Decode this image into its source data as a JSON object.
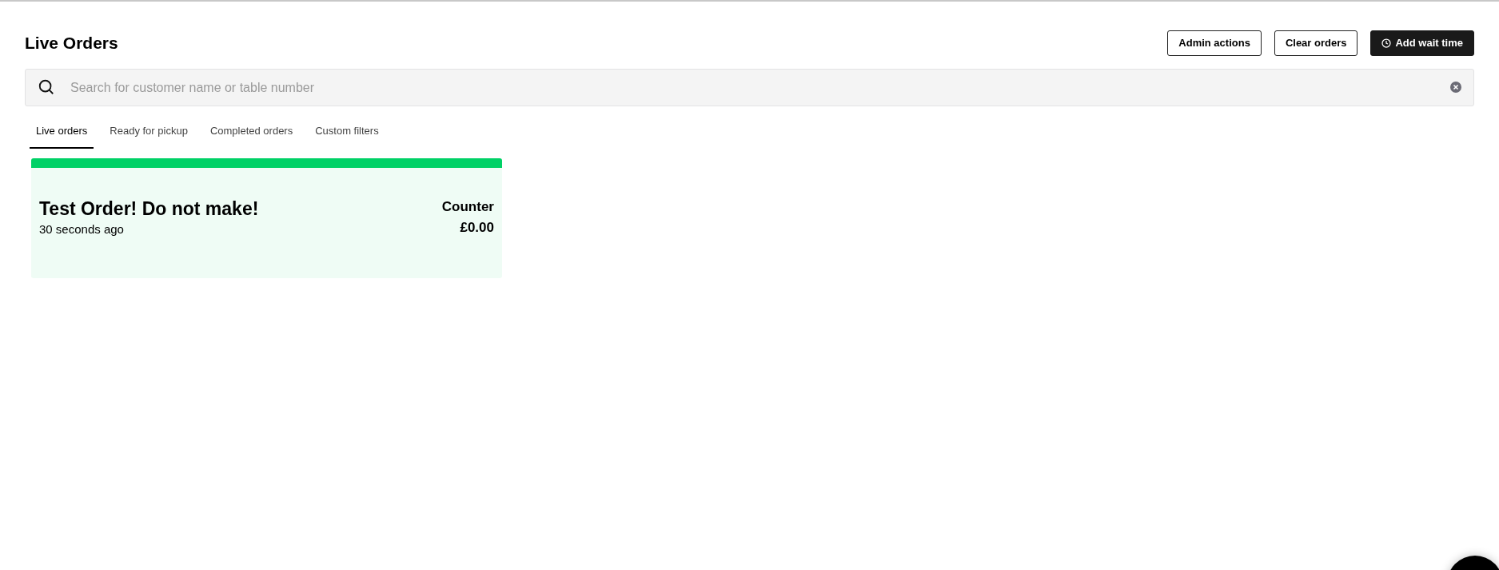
{
  "page": {
    "title": "Live Orders"
  },
  "actions": [
    {
      "label": "Admin actions",
      "kind": "outline"
    },
    {
      "label": "Clear orders",
      "kind": "outline"
    },
    {
      "label": "Add wait time",
      "kind": "primary"
    }
  ],
  "search": {
    "placeholder": "Search for customer name or table number"
  },
  "tabs": [
    {
      "label": "Live orders",
      "selected": true
    },
    {
      "label": "Ready for pickup",
      "selected": false
    },
    {
      "label": "Completed orders",
      "selected": false
    },
    {
      "label": "Custom filters",
      "selected": false
    }
  ],
  "orders": [
    {
      "title": "Test Order! Do not make!",
      "time": "30 seconds ago",
      "location": "Counter",
      "total": "£0.00",
      "color": "#00d166"
    }
  ]
}
